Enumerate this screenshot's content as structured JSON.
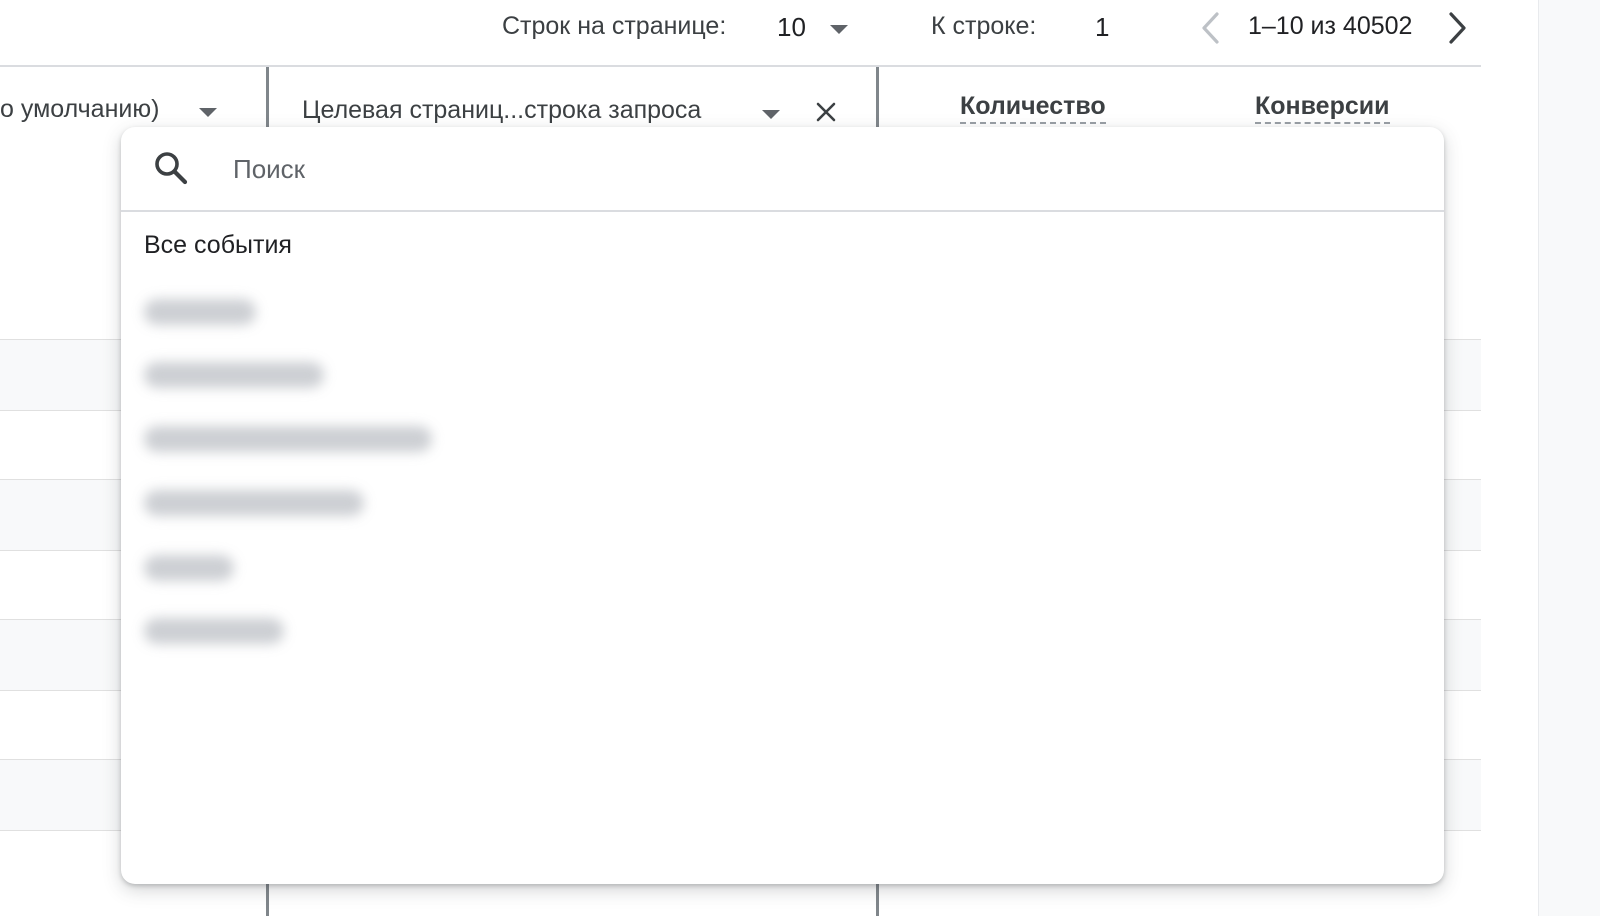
{
  "pagination": {
    "rows_per_page_label": "Строк на странице:",
    "rows_per_page_value": "10",
    "goto_row_label": "К строке:",
    "goto_row_value": "1",
    "range_text": "1–10 из 40502"
  },
  "table": {
    "dimension_1_label": "о умолчанию)",
    "dimension_2_label": "Целевая страниц...строка запроса",
    "metric_headers": [
      "Количество",
      "Конверсии"
    ]
  },
  "dropdown": {
    "search_placeholder": "Поиск",
    "all_events_label": "Все события"
  },
  "icons": {
    "search": "search-icon",
    "close": "close-icon",
    "caret": "caret-down-icon",
    "prev": "chevron-left-icon",
    "next": "chevron-right-icon"
  },
  "colors": {
    "text_primary": "#202124",
    "text_secondary": "#5f6368",
    "divider": "#dadce0",
    "row_band": "#f8f9fa"
  }
}
